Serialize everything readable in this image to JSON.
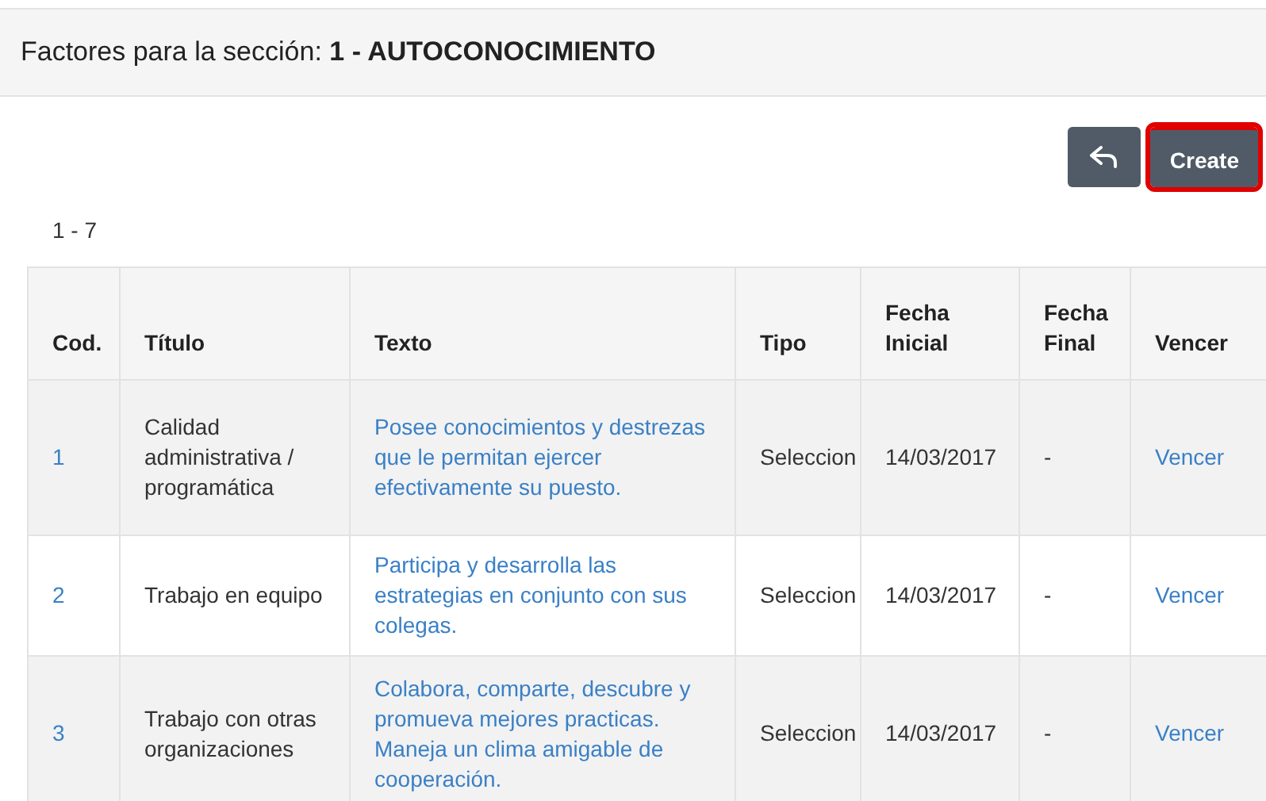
{
  "header": {
    "title": "Factores para la sección: **1 - AUTOCONOCIMIENTO**"
  },
  "actions": [
    {
      "kind": "back",
      "highlighted": false
    },
    {
      "kind": "text",
      "label": "Create",
      "highlighted": true
    }
  ],
  "range": "1 - 7",
  "table": {
    "columns": [
      "Cod.",
      "Título",
      "Texto",
      "Tipo",
      "Fecha Inicial",
      "Fecha Final",
      "Vencer"
    ],
    "rows": [
      {
        "cod": "1",
        "titulo": "Calidad administrativa / programática",
        "texto": "Posee conocimientos y destrezas que le permitan ejercer efectivamente su puesto.",
        "tipo": "Seleccion",
        "fecha_inicial": "14/03/2017",
        "fecha_final": "-",
        "vencer": "Vencer"
      },
      {
        "cod": "2",
        "titulo": "Trabajo en equipo",
        "texto": "Participa y desarrolla las estrategias en conjunto con sus colegas.",
        "tipo": "Seleccion",
        "fecha_inicial": "14/03/2017",
        "fecha_final": "-",
        "vencer": "Vencer"
      },
      {
        "cod": "3",
        "titulo": "Trabajo con otras organizaciones",
        "texto": "Colabora, comparte, descubre y promueva mejores practicas. Maneja un clima amigable de cooperación.",
        "tipo": "Seleccion",
        "fecha_inicial": "14/03/2017",
        "fecha_final": "-",
        "vencer": "Vencer"
      }
    ]
  }
}
